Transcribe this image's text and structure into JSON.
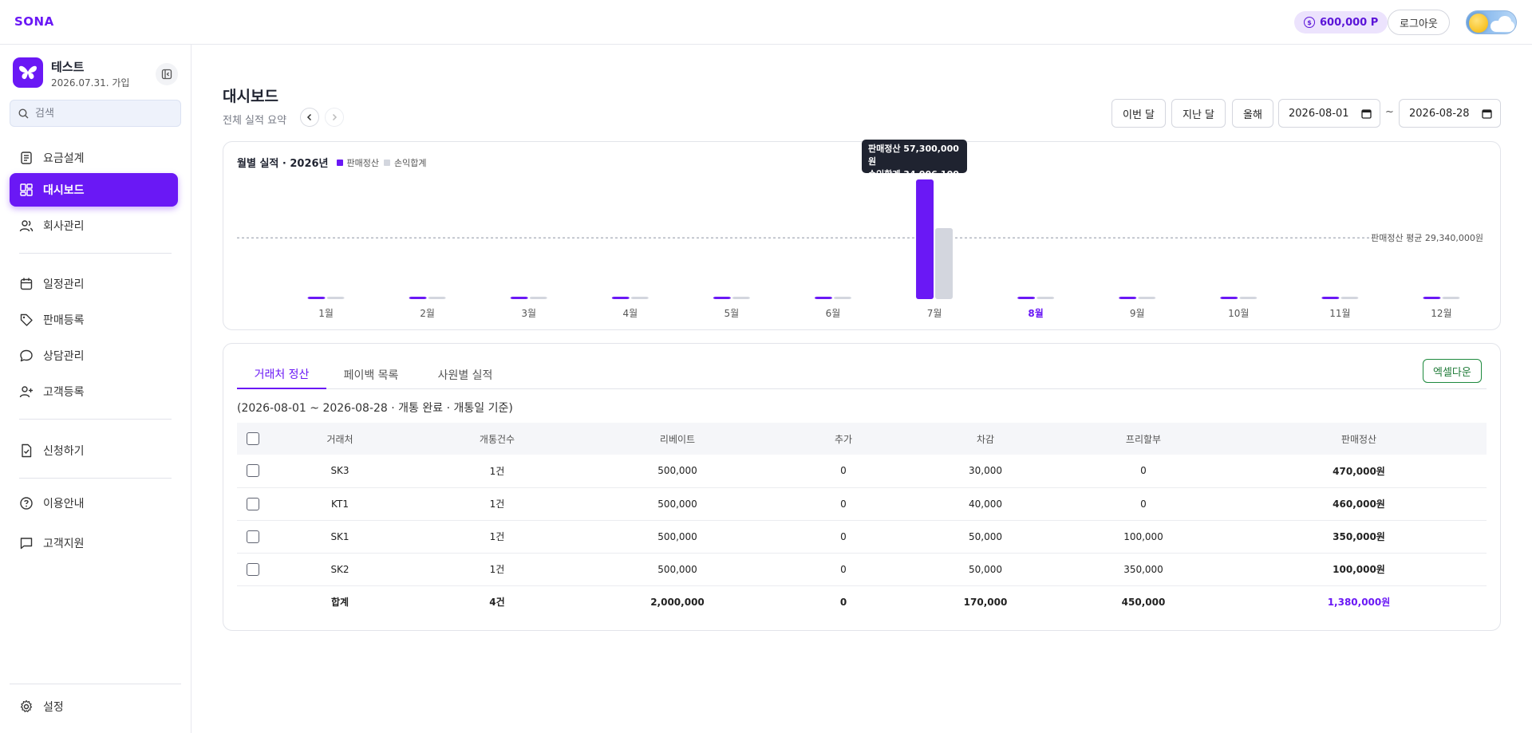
{
  "app": {
    "brand": "SONA"
  },
  "header": {
    "points": "600,000 P",
    "logout": "로그아웃"
  },
  "sidebar": {
    "profile_name": "테스트",
    "joined": "2026.07.31. 가입",
    "search_placeholder": "검색",
    "items": [
      {
        "label": "요금설계",
        "icon": "document-icon"
      },
      {
        "label": "대시보드",
        "icon": "dashboard-icon",
        "active": true
      },
      {
        "label": "회사관리",
        "icon": "users-icon"
      },
      {
        "label": "일정관리",
        "icon": "calendar-icon"
      },
      {
        "label": "판매등록",
        "icon": "tag-icon"
      },
      {
        "label": "상담관리",
        "icon": "chat-icon"
      },
      {
        "label": "고객등록",
        "icon": "user-plus-icon"
      },
      {
        "label": "신청하기",
        "icon": "file-check-icon"
      },
      {
        "label": "이용안내",
        "icon": "help-icon"
      },
      {
        "label": "고객지원",
        "icon": "message-icon"
      },
      {
        "label": "설정",
        "icon": "gear-icon"
      }
    ]
  },
  "main": {
    "title": "대시보드",
    "subtitle": "전체 실적 요약",
    "range_buttons": [
      "이번 달",
      "지난 달",
      "올해"
    ],
    "date_from": "2026-08-01",
    "date_to": "2026-08-28",
    "tilde": "~"
  },
  "chart_data": {
    "type": "bar",
    "title": "월별 실적 · 2026년",
    "categories": [
      "1월",
      "2월",
      "3월",
      "4월",
      "5월",
      "6월",
      "7월",
      "8월",
      "9월",
      "10월",
      "11월",
      "12월"
    ],
    "highlighted_category": "8월",
    "series": [
      {
        "name": "판매정산",
        "color": "#6a18f5",
        "values": [
          0,
          0,
          0,
          0,
          0,
          0,
          57300000,
          0,
          0,
          0,
          0,
          0
        ]
      },
      {
        "name": "손익합계",
        "color": "#d3d6de",
        "values": [
          0,
          0,
          0,
          0,
          0,
          0,
          34006100,
          0,
          0,
          0,
          0,
          0
        ]
      }
    ],
    "ylim": [
      0,
      57300000
    ],
    "reference_line": {
      "value": 29340000,
      "label": "판매정산 평균 29,340,000원"
    },
    "tooltip": {
      "line1": "판매정산 57,300,000원",
      "line2": "손익합계 34,006,100원"
    },
    "legend_placement": "top-left",
    "grid": false
  },
  "table_section": {
    "tabs": [
      "거래처 정산",
      "페이백 목록",
      "사원별 실적"
    ],
    "active_tab": 0,
    "excel_button": "엑셀다운",
    "period": "(2026-08-01 ~ 2026-08-28 · 개통 완료 · 개통일 기준)",
    "columns": [
      "거래처",
      "개통건수",
      "리베이트",
      "추가",
      "차감",
      "프리할부",
      "판매정산"
    ],
    "rows": [
      [
        "SK3",
        "1건",
        "500,000",
        "0",
        "30,000",
        "0",
        "470,000원"
      ],
      [
        "KT1",
        "1건",
        "500,000",
        "0",
        "40,000",
        "0",
        "460,000원"
      ],
      [
        "SK1",
        "1건",
        "500,000",
        "0",
        "50,000",
        "100,000",
        "350,000원"
      ],
      [
        "SK2",
        "1건",
        "500,000",
        "0",
        "50,000",
        "350,000",
        "100,000원"
      ]
    ],
    "total": [
      "합계",
      "4건",
      "2,000,000",
      "0",
      "170,000",
      "450,000",
      "1,380,000원"
    ]
  }
}
